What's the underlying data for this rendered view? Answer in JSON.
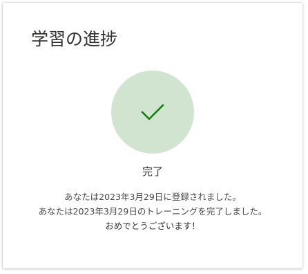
{
  "card": {
    "title": "学習の進捗",
    "status_icon": "checkmark-icon",
    "status_label": "完了",
    "registered_text": "あなたは2023年3月29日に登録されました。",
    "completed_text": "あなたは2023年3月29日のトレーニングを完了しました。",
    "congrats_text": "おめでとうございます！"
  },
  "colors": {
    "circle_fill": "#d0e4cf",
    "check_stroke": "#107c10",
    "text_primary": "#323130"
  }
}
